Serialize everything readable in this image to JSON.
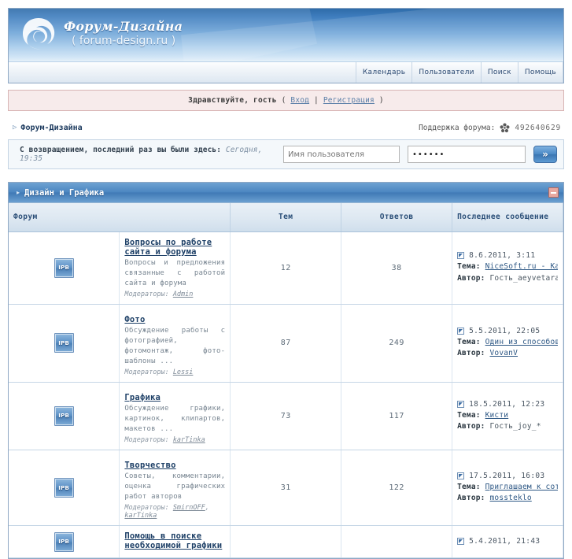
{
  "site": {
    "name": "Форум-Дизайна",
    "url": "( forum-design.ru )",
    "logo_icon": "spiral-logo-icon"
  },
  "nav": {
    "items": [
      {
        "label": "Календарь",
        "name": "nav-calendar"
      },
      {
        "label": "Пользователи",
        "name": "nav-members"
      },
      {
        "label": "Поиск",
        "name": "nav-search"
      },
      {
        "label": "Помощь",
        "name": "nav-help"
      }
    ]
  },
  "greeting": {
    "text": "Здравствуйте, гость",
    "open_paren": "(",
    "login_label": "Вход",
    "separator": "|",
    "register_label": "Регистрация",
    "close_paren": ")"
  },
  "breadcrumb": {
    "arrow": "▷",
    "root": "Форум-Дизайна"
  },
  "support": {
    "label": "Поддержка форума:",
    "icon": "qq-flower-icon",
    "number": "492640629"
  },
  "login_bar": {
    "last_visit_prefix": "С возвращением, последний раз вы были здесь:",
    "last_visit_value": "Сегодня, 19:35",
    "username_placeholder": "Имя пользователя",
    "username_value": "",
    "password_value": "••••••",
    "submit_label": "»"
  },
  "category": {
    "expand_arrow": "▸",
    "title": "Дизайн и Графика",
    "collapse_icon": "collapse-minus-icon",
    "collapse_color": "#e8a8a0"
  },
  "table": {
    "headers": {
      "forum": "Форум",
      "topics": "Тем",
      "replies": "Ответов",
      "last_post": "Последнее сообщение"
    },
    "labels": {
      "moderators": "Модераторы:",
      "topic": "Тема:",
      "author": "Автор:"
    },
    "rows": [
      {
        "icon": "IPB",
        "name": "Вопросы по работе сайта и форума",
        "desc": "Вопросы и предложения связанные с работой сайта и форума",
        "moderators": [
          "Admin"
        ],
        "topics": "12",
        "replies": "38",
        "last_date": "8.6.2011, 3:11",
        "last_topic": "NiceSoft.ru - Как добавить нов...",
        "last_topic_is_link": true,
        "last_author": "Гость_aeyvetara_*",
        "last_author_is_link": false
      },
      {
        "icon": "IPB",
        "name": "Фото",
        "desc": "Обсуждение работы с фотографией, фотомонтаж, фото-шаблоны ...",
        "moderators": [
          "Lessi"
        ],
        "topics": "87",
        "replies": "249",
        "last_date": "5.5.2011, 22:05",
        "last_topic": "Один из способов заработать на...",
        "last_topic_is_link": true,
        "last_author": "VovanV",
        "last_author_is_link": true
      },
      {
        "icon": "IPB",
        "name": "Графика",
        "desc": "Обсуждение графики, картинок, клипартов, макетов ...",
        "moderators": [
          "karTinka"
        ],
        "topics": "73",
        "replies": "117",
        "last_date": "18.5.2011, 12:23",
        "last_topic": "Кисти",
        "last_topic_is_link": true,
        "last_author": "Гость_joy_*",
        "last_author_is_link": false
      },
      {
        "icon": "IPB",
        "name": "Творчество",
        "desc": "Советы, комментарии, оценка графических работ авторов",
        "moderators": [
          "SmirnOFF",
          "karTinka"
        ],
        "topics": "31",
        "replies": "122",
        "last_date": "17.5.2011, 16:03",
        "last_topic": "Приглашаем к сотрудничеству!!!...",
        "last_topic_is_link": true,
        "last_author": "mossteklo",
        "last_author_is_link": true
      },
      {
        "icon": "IPB",
        "name": "Помощь в поиске необходимой графики",
        "desc": "",
        "moderators": [],
        "topics": "",
        "replies": "",
        "last_date": "5.4.2011, 21:43",
        "last_topic": "",
        "last_topic_is_link": true,
        "last_author": "",
        "last_author_is_link": false
      }
    ]
  }
}
